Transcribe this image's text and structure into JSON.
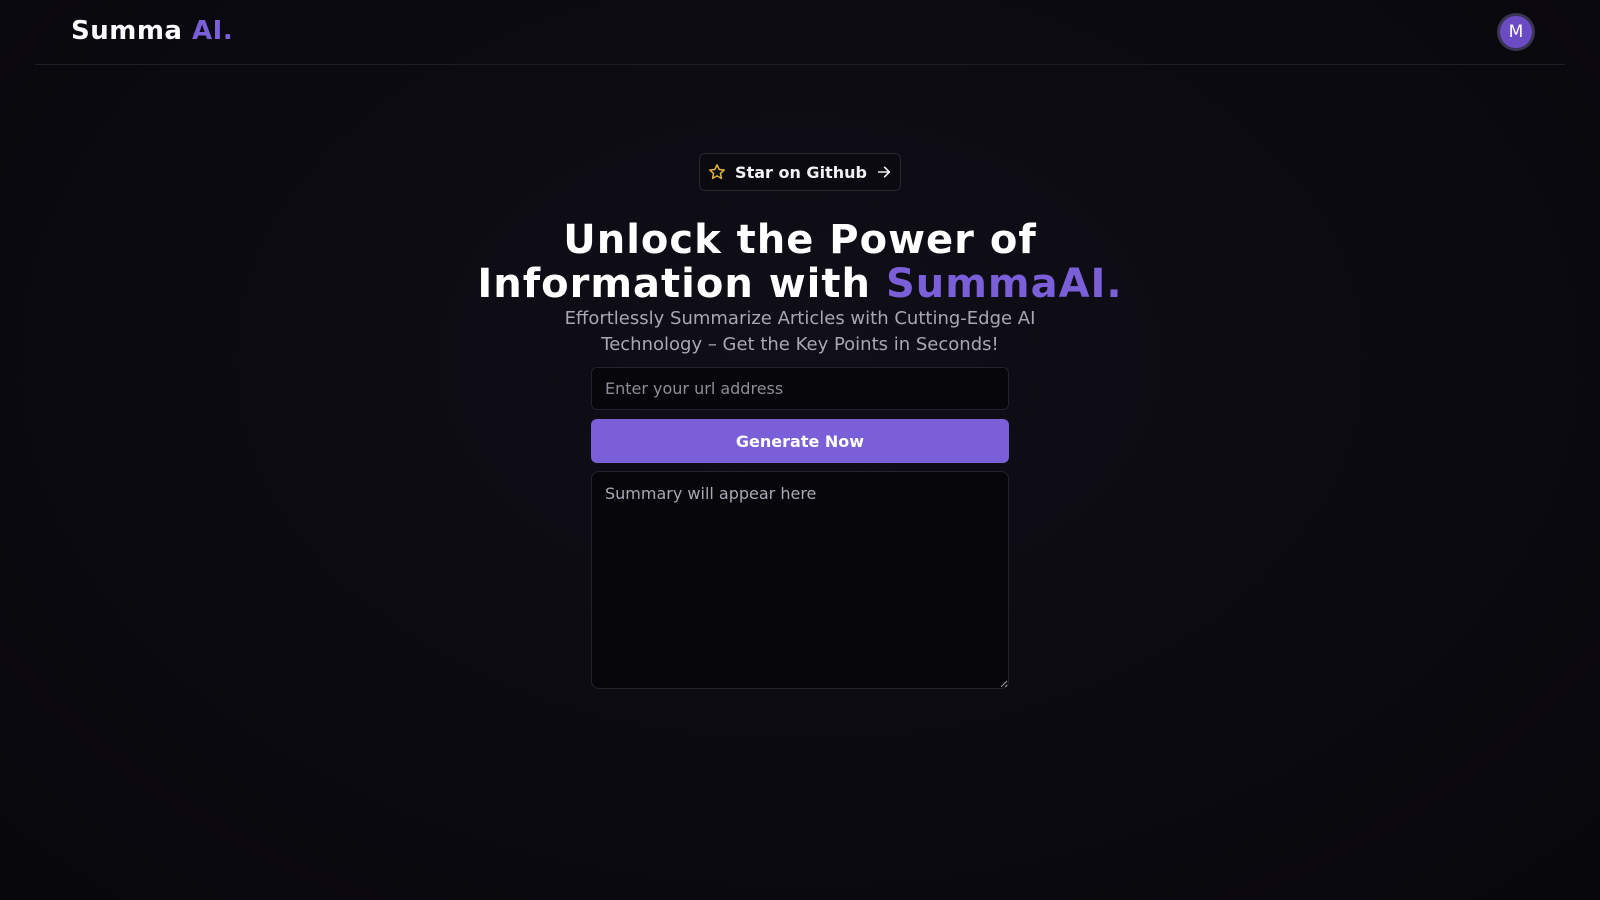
{
  "navbar": {
    "logo_text": "Summa",
    "logo_accent": "AI.",
    "avatar_initial": "M"
  },
  "github_button": {
    "label": "Star on Github",
    "icon_left": "star-icon",
    "icon_right": "arrow-right-icon"
  },
  "hero": {
    "title_line1": "Unlock the Power of",
    "title_line2_prefix": "Information with",
    "title_accent": "SummaAI.",
    "subtitle": "Effortlessly Summarize Articles with Cutting-Edge AI Technology – Get the Key Points in Seconds!"
  },
  "form": {
    "url_placeholder": "Enter your url address",
    "url_value": "",
    "generate_label": "Generate Now",
    "summary_placeholder": "Summary will appear here"
  },
  "colors": {
    "accent": "#7b5fd8",
    "background": "#0b0a10",
    "star": "#e0b341"
  }
}
